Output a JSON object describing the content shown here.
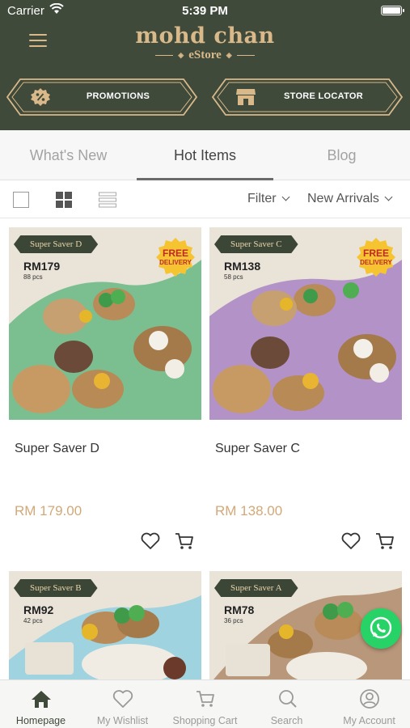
{
  "status_bar": {
    "carrier": "Carrier",
    "time": "5:39 PM"
  },
  "header": {
    "brand": "mohd chan",
    "subbrand": "eStore",
    "buttons": [
      {
        "label": "PROMOTIONS",
        "icon": "percent-badge-icon"
      },
      {
        "label": "STORE LOCATOR",
        "icon": "store-icon"
      }
    ]
  },
  "tabs": [
    {
      "label": "What's New",
      "active": false
    },
    {
      "label": "Hot Items",
      "active": true
    },
    {
      "label": "Blog",
      "active": false
    }
  ],
  "toolbar": {
    "filter_label": "Filter",
    "sort_label": "New Arrivals"
  },
  "products": [
    {
      "name": "Super Saver D",
      "price": "RM 179.00",
      "image": {
        "tag": "Super Saver D",
        "price": "RM179",
        "pcs": "88 pcs",
        "free_line1": "FREE",
        "free_line2": "DELIVERY",
        "bg": "#7bbf91"
      }
    },
    {
      "name": "Super Saver C",
      "price": "RM 138.00",
      "image": {
        "tag": "Super Saver C",
        "price": "RM138",
        "pcs": "58 pcs",
        "free_line1": "FREE",
        "free_line2": "DELIVERY",
        "bg": "#b393c7"
      }
    },
    {
      "name": "",
      "price": "",
      "image": {
        "tag": "Super Saver B",
        "price": "RM92",
        "pcs": "42 pcs",
        "bg": "#9fd3e0"
      }
    },
    {
      "name": "",
      "price": "",
      "image": {
        "tag": "Super Saver A",
        "price": "RM78",
        "pcs": "36 pcs",
        "bg": "#b8977a"
      }
    }
  ],
  "bottom_nav": [
    {
      "label": "Homepage",
      "icon": "home-icon",
      "active": true
    },
    {
      "label": "My Wishlist",
      "icon": "heart-icon",
      "active": false
    },
    {
      "label": "Shopping Cart",
      "icon": "cart-icon",
      "active": false
    },
    {
      "label": "Search",
      "icon": "search-icon",
      "active": false
    },
    {
      "label": "My Account",
      "icon": "account-icon",
      "active": false
    }
  ],
  "colors": {
    "header_bg": "#3f4a3b",
    "gold": "#d9b98a",
    "price": "#d3a878",
    "whatsapp": "#27d367"
  }
}
